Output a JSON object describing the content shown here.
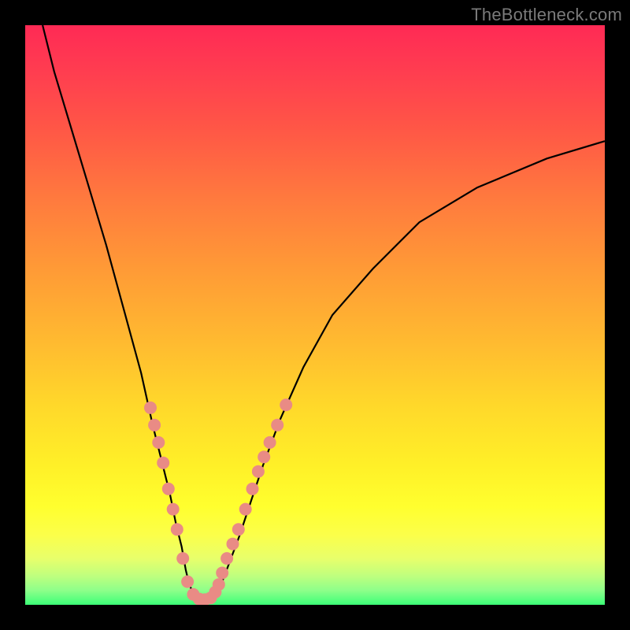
{
  "watermark": "TheBottleneck.com",
  "chart_data": {
    "type": "line",
    "title": "",
    "xlabel": "",
    "ylabel": "",
    "xlim": [
      0,
      100
    ],
    "ylim": [
      0,
      100
    ],
    "grid": false,
    "legend": false,
    "background": "gradient-red-to-green",
    "series": [
      {
        "name": "curve",
        "x": [
          3,
          5,
          8,
          11,
          14,
          17,
          20,
          22,
          23.5,
          25,
          26,
          27,
          27.7,
          28.3,
          29,
          30,
          31,
          32,
          33,
          34,
          35.5,
          37,
          39,
          41,
          44,
          48,
          53,
          60,
          68,
          78,
          90,
          100
        ],
        "y": [
          100,
          92,
          82,
          72,
          62,
          51,
          40,
          31,
          25,
          19,
          14,
          10,
          6,
          3.5,
          2,
          1,
          0.8,
          1,
          2,
          4,
          8,
          12,
          18,
          24,
          32,
          41,
          50,
          58,
          66,
          72,
          77,
          80
        ]
      }
    ],
    "dots": {
      "name": "markers",
      "points": [
        [
          21.6,
          34.0
        ],
        [
          22.3,
          31.0
        ],
        [
          23.0,
          28.0
        ],
        [
          23.8,
          24.5
        ],
        [
          24.7,
          20.0
        ],
        [
          25.5,
          16.5
        ],
        [
          26.2,
          13.0
        ],
        [
          27.2,
          8.0
        ],
        [
          28.0,
          4.0
        ],
        [
          29.0,
          1.8
        ],
        [
          30.0,
          1.0
        ],
        [
          31.0,
          0.9
        ],
        [
          32.0,
          1.2
        ],
        [
          32.8,
          2.2
        ],
        [
          33.4,
          3.5
        ],
        [
          34.0,
          5.5
        ],
        [
          34.8,
          8.0
        ],
        [
          35.8,
          10.5
        ],
        [
          36.8,
          13.0
        ],
        [
          38.0,
          16.5
        ],
        [
          39.2,
          20.0
        ],
        [
          40.2,
          23.0
        ],
        [
          41.2,
          25.5
        ],
        [
          42.2,
          28.0
        ],
        [
          43.5,
          31.0
        ],
        [
          45.0,
          34.5
        ]
      ]
    }
  }
}
